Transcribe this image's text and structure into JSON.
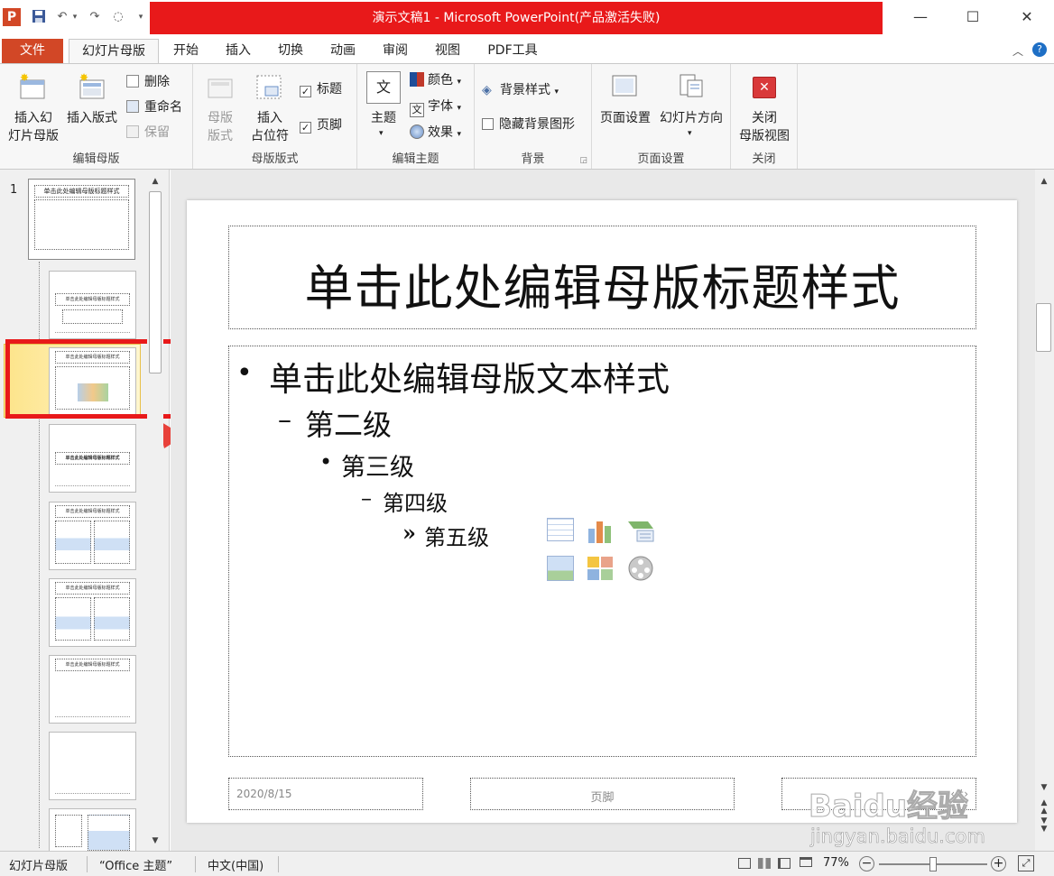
{
  "window": {
    "title": "演示文稿1 - Microsoft PowerPoint(产品激活失败)",
    "app_icon": "P",
    "controls": {
      "minimize": "—",
      "maximize": "☐",
      "close": "✕"
    }
  },
  "tabs": [
    "文件",
    "幻灯片母版",
    "开始",
    "插入",
    "切换",
    "动画",
    "审阅",
    "视图",
    "PDF工具"
  ],
  "ribbon": {
    "edit_master": {
      "label": "编辑母版",
      "insert_slide_master": "插入幻\n灯片母版",
      "insert_layout": "插入版式",
      "delete": "删除",
      "rename": "重命名",
      "preserve": "保留"
    },
    "master_layout": {
      "label": "母版版式",
      "master_layout_btn": "母版\n版式",
      "insert_placeholder": "插入\n占位符",
      "title_check": "标题",
      "footer_check": "页脚"
    },
    "edit_theme": {
      "label": "编辑主题",
      "themes": "主题",
      "colors": "颜色",
      "fonts": "字体",
      "effects": "效果"
    },
    "background": {
      "label": "背景",
      "bg_styles": "背景样式",
      "hide_bg": "隐藏背景图形"
    },
    "page_setup": {
      "label": "页面设置",
      "page_setup_btn": "页面设置",
      "orientation": "幻灯片方向"
    },
    "close": {
      "label": "关闭",
      "close_master": "关闭\n母版视图"
    }
  },
  "thumbnails": {
    "master_number": "1",
    "master_title": "单击此处编辑母版标题样式",
    "layout_title": "单击此处编辑母版标题样式"
  },
  "slide": {
    "title": "单击此处编辑母版标题样式",
    "level1": "单击此处编辑母版文本样式",
    "level2": "第二级",
    "level3": "第三级",
    "level4": "第四级",
    "level5": "第五级",
    "bullet1": "•",
    "bullet2": "–",
    "bullet3": "•",
    "bullet4": "–",
    "bullet5": "»",
    "date": "2020/8/15",
    "footer": "页脚",
    "page_number": "‹#›"
  },
  "watermark": {
    "brand": "Baidu经验",
    "url": "jingyan.baidu.com"
  },
  "status": {
    "view": "幻灯片母版",
    "theme": "“Office 主题”",
    "language": "中文(中国)",
    "zoom": "77%",
    "zoom_level_fraction": 0.5
  },
  "colors": {
    "accent_red": "#e8191a",
    "file_tab": "#d24726",
    "highlight_box": "#e8191a"
  }
}
